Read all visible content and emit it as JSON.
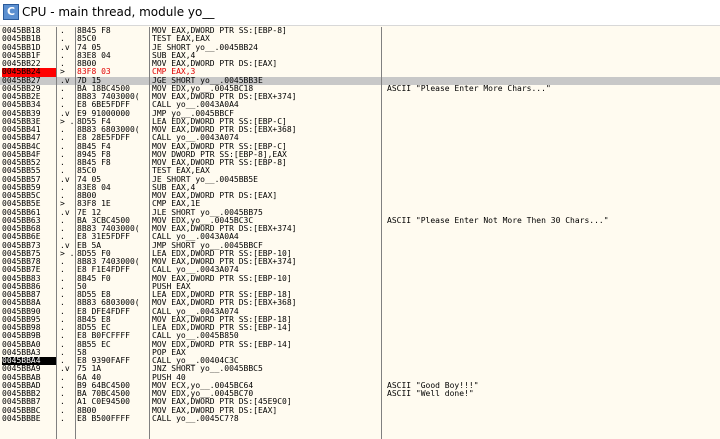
{
  "window": {
    "title": "CPU - main thread, module yo__",
    "icon": "C"
  },
  "rows": [
    {
      "addr": "0045BB18",
      "gut": ".",
      "hex": "8B45 F8",
      "ins": "MOV EAX,DWORD PTR SS:[EBP-8]",
      "cmt": ""
    },
    {
      "addr": "0045BB1B",
      "gut": ".",
      "hex": "85C0",
      "ins": "TEST EAX,EAX",
      "cmt": ""
    },
    {
      "addr": "0045BB1D",
      "gut": ".v",
      "hex": "74 05",
      "ins": "JE SHORT yo__.0045BB24",
      "cmt": ""
    },
    {
      "addr": "0045BB1F",
      "gut": ".",
      "hex": "83E8 04",
      "ins": "SUB EAX,4",
      "cmt": ""
    },
    {
      "addr": "0045BB22",
      "gut": ".",
      "hex": "8B00",
      "ins": "MOV EAX,DWORD PTR DS:[EAX]",
      "cmt": ""
    },
    {
      "addr": "0045BB24",
      "gut": ">",
      "hex": "83F8 03",
      "ins": "CMP EAX,3",
      "cmt": "",
      "state": "bp"
    },
    {
      "addr": "0045BB27",
      "gut": ".v",
      "hex": "7D 15",
      "ins": "JGE SHORT yo__.0045BB3E",
      "cmt": "",
      "state": "sel"
    },
    {
      "addr": "0045BB29",
      "gut": ".",
      "hex": "BA 18BC4500",
      "ins": "MOV EDX,yo__.0045BC18",
      "cmt": "ASCII \"Please Enter More Chars...\""
    },
    {
      "addr": "0045BB2E",
      "gut": ".",
      "hex": "8B83 7403000(",
      "ins": "MOV EAX,DWORD PTR DS:[EBX+374]",
      "cmt": ""
    },
    {
      "addr": "0045BB34",
      "gut": ".",
      "hex": "E8 6BE5FDFF",
      "ins": "CALL yo__.0043A0A4",
      "cmt": ""
    },
    {
      "addr": "0045BB39",
      "gut": ".v",
      "hex": "E9 91000000",
      "ins": "JMP yo__.0045BBCF",
      "cmt": ""
    },
    {
      "addr": "0045BB3E",
      "gut": "> .",
      "hex": "8D55 F4",
      "ins": "LEA EDX,DWORD PTR SS:[EBP-C]",
      "cmt": ""
    },
    {
      "addr": "0045BB41",
      "gut": ".",
      "hex": "8B83 6803000(",
      "ins": "MOV EAX,DWORD PTR DS:[EBX+368]",
      "cmt": ""
    },
    {
      "addr": "0045BB47",
      "gut": ".",
      "hex": "E8 28E5FDFF",
      "ins": "CALL yo__.0043A074",
      "cmt": ""
    },
    {
      "addr": "0045BB4C",
      "gut": ".",
      "hex": "8B45 F4",
      "ins": "MOV EAX,DWORD PTR SS:[EBP-C]",
      "cmt": ""
    },
    {
      "addr": "0045BB4F",
      "gut": ".",
      "hex": "8945 F8",
      "ins": "MOV DWORD PTR SS:[EBP-8],EAX",
      "cmt": ""
    },
    {
      "addr": "0045BB52",
      "gut": ".",
      "hex": "8B45 F8",
      "ins": "MOV EAX,DWORD PTR SS:[EBP-8]",
      "cmt": ""
    },
    {
      "addr": "0045BB55",
      "gut": ".",
      "hex": "85C0",
      "ins": "TEST EAX,EAX",
      "cmt": ""
    },
    {
      "addr": "0045BB57",
      "gut": ".v",
      "hex": "74 05",
      "ins": "JE SHORT yo__.0045BB5E",
      "cmt": ""
    },
    {
      "addr": "0045BB59",
      "gut": ".",
      "hex": "83E8 04",
      "ins": "SUB EAX,4",
      "cmt": ""
    },
    {
      "addr": "0045BB5C",
      "gut": ".",
      "hex": "8B00",
      "ins": "MOV EAX,DWORD PTR DS:[EAX]",
      "cmt": ""
    },
    {
      "addr": "0045BB5E",
      "gut": ">",
      "hex": "83F8 1E",
      "ins": "CMP EAX,1E",
      "cmt": ""
    },
    {
      "addr": "0045BB61",
      "gut": ".v",
      "hex": "7E 12",
      "ins": "JLE SHORT yo__.0045BB75",
      "cmt": ""
    },
    {
      "addr": "0045BB63",
      "gut": ".",
      "hex": "BA 3CBC4500",
      "ins": "MOV EDX,yo__.0045BC3C",
      "cmt": "ASCII \"Please Enter Not More Then 30 Chars...\""
    },
    {
      "addr": "0045BB68",
      "gut": ".",
      "hex": "8B83 7403000(",
      "ins": "MOV EAX,DWORD PTR DS:[EBX+374]",
      "cmt": ""
    },
    {
      "addr": "0045BB6E",
      "gut": ".",
      "hex": "E8 31E5FDFF",
      "ins": "CALL yo__.0043A0A4",
      "cmt": ""
    },
    {
      "addr": "0045BB73",
      "gut": ".v",
      "hex": "EB 5A",
      "ins": "JMP SHORT yo__.0045BBCF",
      "cmt": ""
    },
    {
      "addr": "0045BB75",
      "gut": "> .",
      "hex": "8D55 F0",
      "ins": "LEA EDX,DWORD PTR SS:[EBP-10]",
      "cmt": ""
    },
    {
      "addr": "0045BB78",
      "gut": ".",
      "hex": "8B83 7403000(",
      "ins": "MOV EAX,DWORD PTR DS:[EBX+374]",
      "cmt": ""
    },
    {
      "addr": "0045BB7E",
      "gut": ".",
      "hex": "E8 F1E4FDFF",
      "ins": "CALL yo__.0043A074",
      "cmt": ""
    },
    {
      "addr": "0045BB83",
      "gut": ".",
      "hex": "8B45 F0",
      "ins": "MOV EAX,DWORD PTR SS:[EBP-10]",
      "cmt": ""
    },
    {
      "addr": "0045BB86",
      "gut": ".",
      "hex": "50",
      "ins": "PUSH EAX",
      "cmt": ""
    },
    {
      "addr": "0045BB87",
      "gut": ".",
      "hex": "8D55 E8",
      "ins": "LEA EDX,DWORD PTR SS:[EBP-18]",
      "cmt": ""
    },
    {
      "addr": "0045BB8A",
      "gut": ".",
      "hex": "8B83 6803000(",
      "ins": "MOV EAX,DWORD PTR DS:[EBX+368]",
      "cmt": ""
    },
    {
      "addr": "0045BB90",
      "gut": ".",
      "hex": "E8 DFE4FDFF",
      "ins": "CALL yo__.0043A074",
      "cmt": ""
    },
    {
      "addr": "0045BB95",
      "gut": ".",
      "hex": "8B45 E8",
      "ins": "MOV EAX,DWORD PTR SS:[EBP-18]",
      "cmt": ""
    },
    {
      "addr": "0045BB98",
      "gut": ".",
      "hex": "8D55 EC",
      "ins": "LEA EDX,DWORD PTR SS:[EBP-14]",
      "cmt": ""
    },
    {
      "addr": "0045BB9B",
      "gut": ".",
      "hex": "E8 B0FCFFFF",
      "ins": "CALL yo__.0045B850",
      "cmt": ""
    },
    {
      "addr": "0045BBA0",
      "gut": ".",
      "hex": "8B55 EC",
      "ins": "MOV EDX,DWORD PTR SS:[EBP-14]",
      "cmt": ""
    },
    {
      "addr": "0045BBA3",
      "gut": ".",
      "hex": "58",
      "ins": "POP EAX",
      "cmt": ""
    },
    {
      "addr": "0045BBA4",
      "gut": ".",
      "hex": "E8 9390FAFF",
      "ins": "CALL yo__.00404C3C",
      "cmt": "",
      "state": "cur"
    },
    {
      "addr": "0045BBA9",
      "gut": ".v",
      "hex": "75 1A",
      "ins": "JNZ SHORT yo__.0045BBC5",
      "cmt": ""
    },
    {
      "addr": "0045BBAB",
      "gut": ".",
      "hex": "6A 40",
      "ins": "PUSH 40",
      "cmt": ""
    },
    {
      "addr": "0045BBAD",
      "gut": ".",
      "hex": "B9 64BC4500",
      "ins": "MOV ECX,yo__.0045BC64",
      "cmt": "ASCII \"Good Boy!!!\""
    },
    {
      "addr": "0045BBB2",
      "gut": ".",
      "hex": "BA 70BC4500",
      "ins": "MOV EDX,yo__.0045BC70",
      "cmt": "ASCII \"Well done!\""
    },
    {
      "addr": "0045BBB7",
      "gut": ".",
      "hex": "A1 C0E94500",
      "ins": "MOV EAX,DWORD PTR DS:[45E9C0]",
      "cmt": ""
    },
    {
      "addr": "0045BBBC",
      "gut": ".",
      "hex": "8B00",
      "ins": "MOV EAX,DWORD PTR DS:[EAX]",
      "cmt": ""
    },
    {
      "addr": "0045BBBE",
      "gut": ".",
      "hex": "E8 B500FFFF",
      "ins": "CALL yo__.0045C7?8",
      "cmt": ""
    }
  ]
}
